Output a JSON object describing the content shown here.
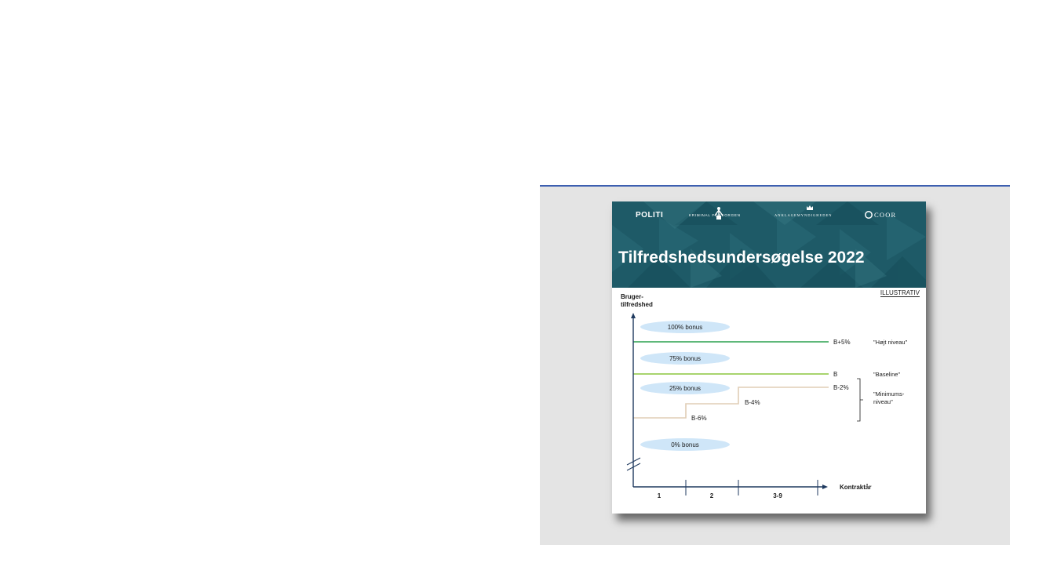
{
  "header": {
    "logos": {
      "politi": "POLITI",
      "kriminalforsorgen": "KRIMINAL FORSORGEN",
      "anklagemyndigheden": "ANKLAGEMYNDIGHEDEN",
      "coor": "COOR"
    },
    "title": "Tilfredshedsundersøgelse 2022"
  },
  "stamp": "ILLUSTRATIV",
  "chart_data": {
    "type": "step",
    "y_axis_label_line1": "Bruger-",
    "y_axis_label_line2": "tilfredshed",
    "x_axis_label": "Kontraktår",
    "x_categories": [
      "1",
      "2",
      "3-9"
    ],
    "bonus_bands": [
      "100% bonus",
      "75% bonus",
      "25% bonus",
      "0% bonus"
    ],
    "levels": [
      {
        "label": "B+5%",
        "note": "\"Højt niveau\"",
        "color": "#2aa14f"
      },
      {
        "label": "B",
        "note": "\"Baseline\"",
        "color": "#8cc63f"
      }
    ],
    "minimum_steps": [
      "B-6%",
      "B-4%",
      "B-2%"
    ],
    "minimum_note_line1": "\"Minimums-",
    "minimum_note_line2": "niveau\"",
    "minimum_color": "#e0cdb6",
    "band_color": "#cfe6f8",
    "axis_color": "#1f3a5f"
  }
}
